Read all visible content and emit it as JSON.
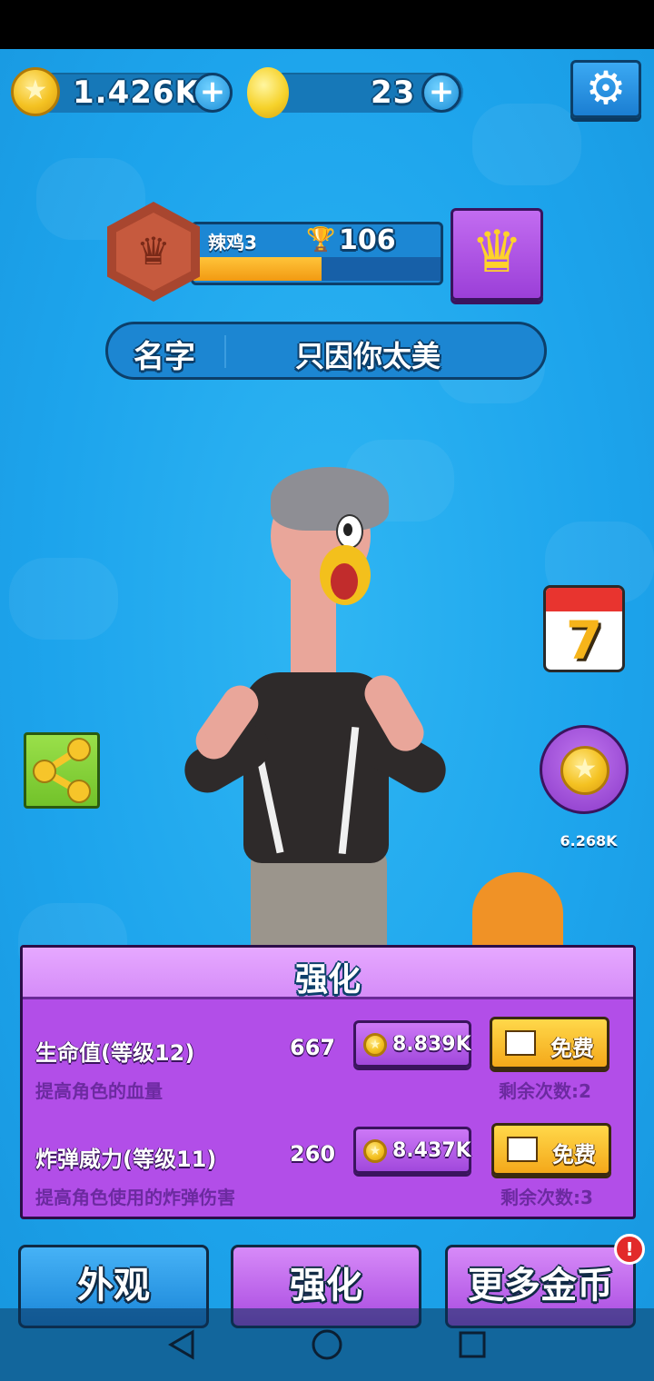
{
  "currency": {
    "coins": "1.426K",
    "gems": "23",
    "plus": "+"
  },
  "settings": {
    "icon": "gear-icon"
  },
  "rank": {
    "name": "辣鸡3",
    "trophies": "106",
    "progress": 0.52
  },
  "player": {
    "name_label": "名字",
    "name_value": "只因你太美"
  },
  "side": {
    "calendar_day": "7",
    "coin_shop_amount": "6.268K"
  },
  "upgrade": {
    "title": "强化",
    "rows": [
      {
        "title": "生命值(等级12)",
        "desc": "提高角色的血量",
        "value": "667",
        "cost": "8.839K",
        "free_label": "免费",
        "remaining": "剩余次数:2"
      },
      {
        "title": "炸弹威力(等级11)",
        "desc": "提高角色使用的炸弹伤害",
        "value": "260",
        "cost": "8.437K",
        "free_label": "免费",
        "remaining": "剩余次数:3"
      }
    ]
  },
  "tabs": {
    "appearance": "外观",
    "upgrade": "强化",
    "more_coins": "更多金币",
    "notification": "!"
  },
  "colors": {
    "background": "#1da7ee",
    "panel": "#b24ee8",
    "tab_blue": "#2a9ae6",
    "tab_purple": "#c36df0",
    "free_button": "#f4b22a"
  }
}
